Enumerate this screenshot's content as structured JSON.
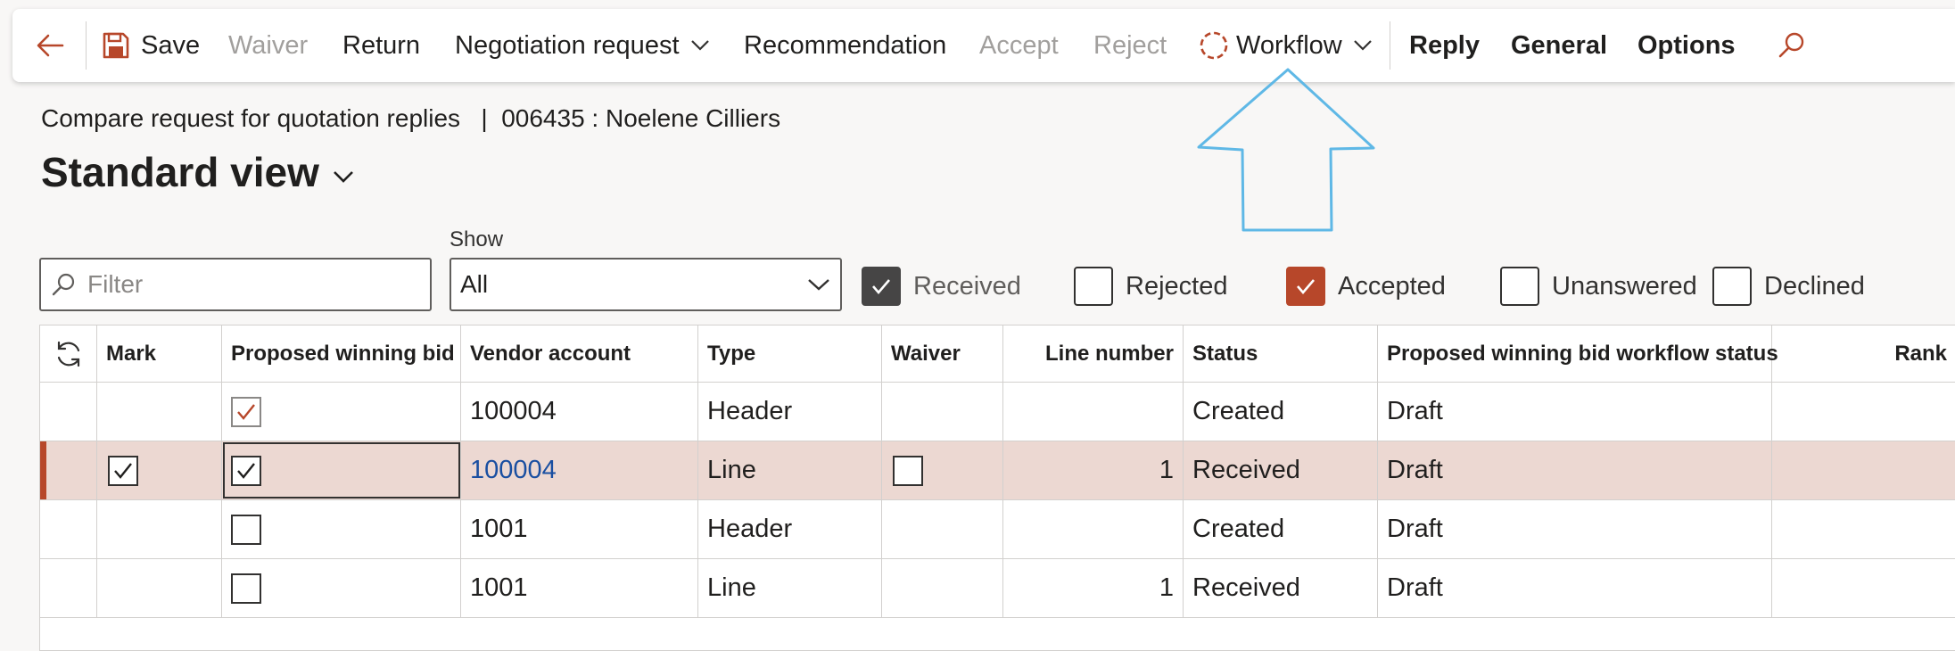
{
  "actionpane": {
    "back_icon": "arrow-left-icon",
    "save": "Save",
    "waiver": "Waiver",
    "return": "Return",
    "negotiation_request": "Negotiation request",
    "recommendation": "Recommendation",
    "accept": "Accept",
    "reject": "Reject",
    "workflow": "Workflow",
    "reply": "Reply",
    "general": "General",
    "options": "Options",
    "search_icon": "search-icon",
    "accent_color": "#b7472a"
  },
  "page": {
    "breadcrumb": "Compare request for quotation replies   |  006435 : Noelene Cilliers",
    "view_name": "Standard view"
  },
  "filters": {
    "filter_placeholder": "Filter",
    "show_label": "Show",
    "show_value": "All",
    "received": {
      "label": "Received",
      "checked": true
    },
    "rejected": {
      "label": "Rejected",
      "checked": false
    },
    "accepted": {
      "label": "Accepted",
      "checked": true
    },
    "unanswered": {
      "label": "Unanswered",
      "checked": false
    },
    "declined": {
      "label": "Declined",
      "checked": false
    }
  },
  "grid": {
    "columns": {
      "mark": "Mark",
      "proposed": "Proposed winning bid",
      "vendor": "Vendor account",
      "type": "Type",
      "waiver": "Waiver",
      "line": "Line number",
      "status": "Status",
      "workflow_status": "Proposed winning bid workflow status",
      "rank": "Rank"
    },
    "rows": [
      {
        "mark": null,
        "proposed": true,
        "vendor": "100004",
        "type": "Header",
        "waiver": null,
        "line": "",
        "status": "Created",
        "workflow_status": "Draft",
        "rank": ""
      },
      {
        "mark": true,
        "proposed": true,
        "vendor": "100004",
        "type": "Line",
        "waiver": false,
        "line": "1",
        "status": "Received",
        "workflow_status": "Draft",
        "rank": ""
      },
      {
        "mark": null,
        "proposed": false,
        "vendor": "1001",
        "type": "Header",
        "waiver": null,
        "line": "",
        "status": "Created",
        "workflow_status": "Draft",
        "rank": ""
      },
      {
        "mark": null,
        "proposed": false,
        "vendor": "1001",
        "type": "Line",
        "waiver": null,
        "line": "1",
        "status": "Received",
        "workflow_status": "Draft",
        "rank": ""
      }
    ]
  }
}
